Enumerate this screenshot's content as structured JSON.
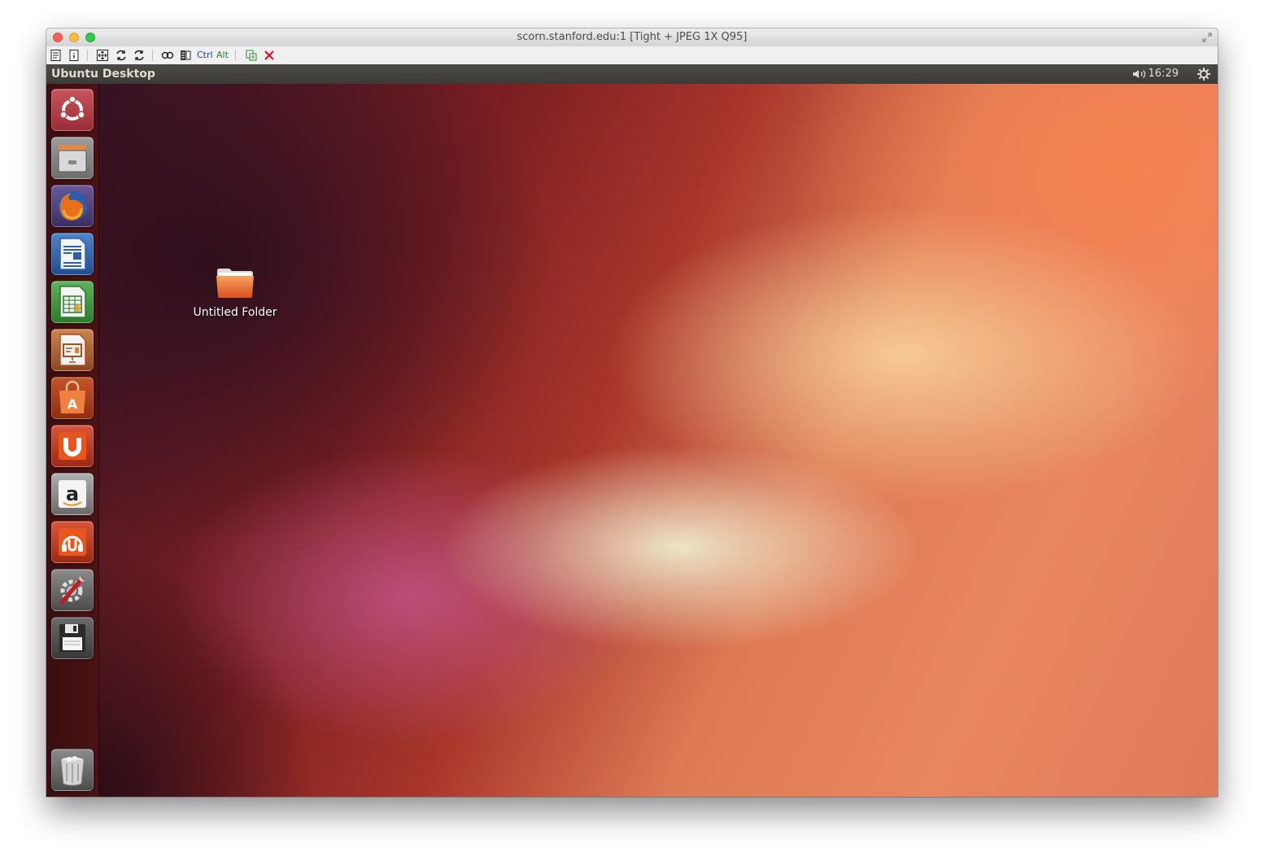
{
  "window": {
    "title": "scorn.stanford.edu:1 [Tight + JPEG 1X Q95]"
  },
  "toolbar": {
    "ctrl_label": "Ctrl",
    "alt_label": "Alt",
    "icons": [
      "connection-options-icon",
      "connection-info-icon",
      "full-screen-icon",
      "refresh-icon",
      "refresh-icon",
      "send-ctrl-alt-del-icon",
      "file-transfer-icon",
      "ctrl-key-icon",
      "alt-key-icon",
      "clipboard-icon",
      "disconnect-icon"
    ]
  },
  "panel": {
    "title": "Ubuntu Desktop",
    "clock": "16:29"
  },
  "launcher": {
    "items": [
      {
        "name": "dash-home",
        "icon": "ubuntu-logo-icon",
        "color": "#b84048"
      },
      {
        "name": "files",
        "icon": "file-cabinet-icon",
        "color": "#8c8c8c"
      },
      {
        "name": "firefox",
        "icon": "firefox-icon",
        "color": "#e66a1e"
      },
      {
        "name": "libreoffice-writer",
        "icon": "writer-document-icon",
        "color": "#2f5fa7"
      },
      {
        "name": "libreoffice-calc",
        "icon": "calc-spreadsheet-icon",
        "color": "#3a9a3a"
      },
      {
        "name": "libreoffice-impress",
        "icon": "impress-presentation-icon",
        "color": "#c0632a"
      },
      {
        "name": "ubuntu-software-center",
        "icon": "software-center-bag-icon",
        "color": "#e3662d"
      },
      {
        "name": "ubuntu-one",
        "icon": "ubuntu-one-icon",
        "color": "#dd4814"
      },
      {
        "name": "amazon",
        "icon": "amazon-icon",
        "color": "#e8e8e8"
      },
      {
        "name": "ubuntu-one-music",
        "icon": "ubuntu-one-music-icon",
        "color": "#dd4814"
      },
      {
        "name": "system-settings",
        "icon": "settings-tools-icon",
        "color": "#9a9a9a"
      },
      {
        "name": "removable-drive",
        "icon": "floppy-disk-icon",
        "color": "#555555"
      },
      {
        "name": "trash",
        "icon": "trash-icon",
        "color": "#b0b0b0"
      }
    ]
  },
  "desktop": {
    "folder_label": "Untitled Folder"
  }
}
